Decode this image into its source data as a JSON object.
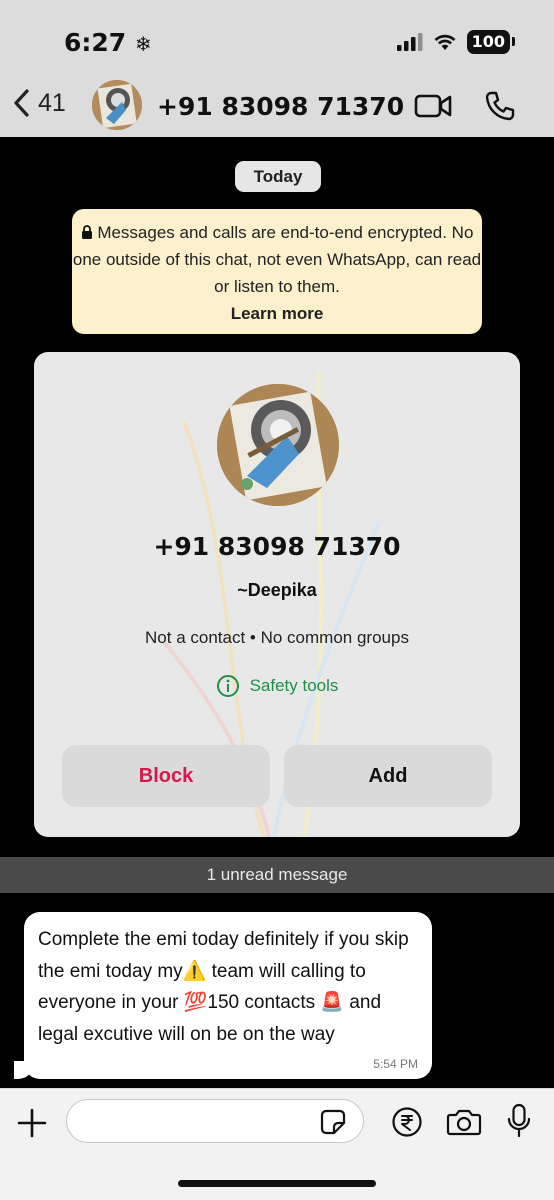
{
  "status_bar": {
    "time": "6:27",
    "battery": "100"
  },
  "header": {
    "back_count": "41",
    "contact_title": "+91 83098 71370"
  },
  "chat": {
    "date_label": "Today",
    "encryption_notice": "Messages and calls are end-to-end encrypted. No one outside of this chat, not even WhatsApp, can read or listen to them.",
    "learn_more": "Learn more",
    "contact_card": {
      "phone": "+91 83098 71370",
      "name": "~Deepika",
      "meta": "Not a contact • No common groups",
      "safety_tools": "Safety tools",
      "block_label": "Block",
      "add_label": "Add"
    },
    "unread_banner": "1 unread message",
    "message": {
      "text": "Complete the emi today definitely if you skip the emi today my⚠️ team will calling to everyone in your 💯150 contacts 🚨 and legal excutive will on be on the way",
      "time": "5:54 PM"
    }
  },
  "composer": {
    "value": "",
    "placeholder": ""
  },
  "colors": {
    "header_bg": "#dcdcdc",
    "encryption_bg": "#fdf0cc",
    "block_red": "#d6184a",
    "safety_green": "#1f8f4a"
  },
  "icons": [
    "snowflake-icon",
    "signal-icon",
    "wifi-icon",
    "chevron-left-icon",
    "video-icon",
    "phone-icon",
    "lock-icon",
    "info-icon",
    "plus-icon",
    "sticker-icon",
    "rupee-icon",
    "camera-icon",
    "mic-icon"
  ]
}
